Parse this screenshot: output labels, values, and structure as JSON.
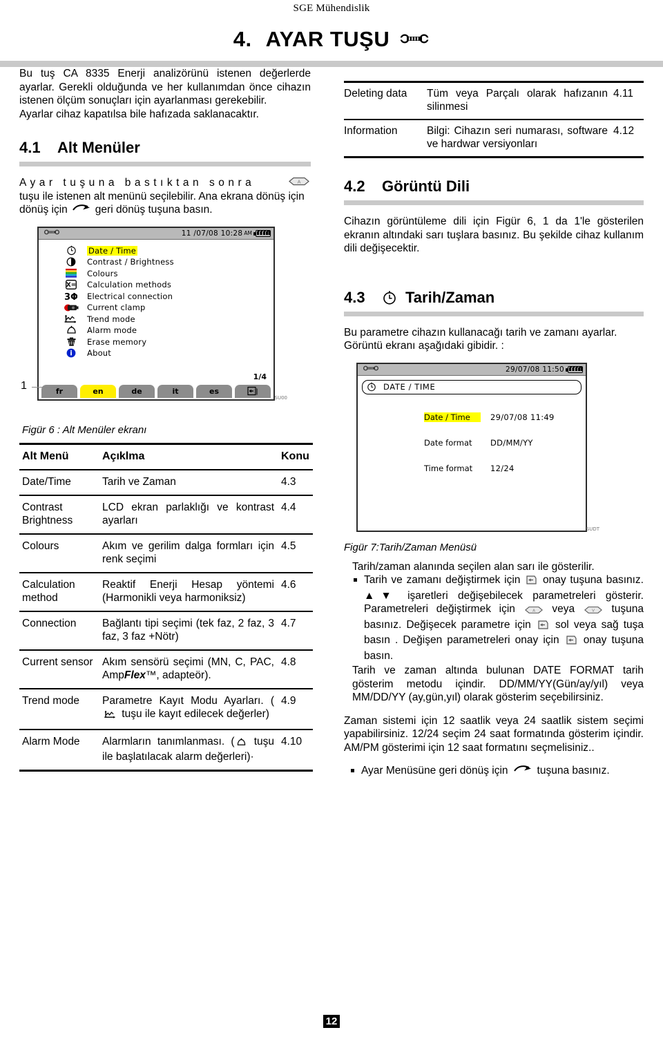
{
  "header": {
    "company": "SGE Mühendislik",
    "chapter_number": "4.",
    "chapter_title": "AYAR TUŞU",
    "chapter_icon": "wrench-icon"
  },
  "intro": {
    "paragraph": "Bu tuş CA 8335 Enerji analizörünü istenen değerlerde ayarlar. Gerekli olduğunda ve her kullanımdan önce cihazın istenen ölçüm sonuçları için ayarlanması gerekebilir.",
    "paragraph2": "Ayarlar cihaz kapatılsa bile hafızada saklanacaktır."
  },
  "section41": {
    "number": "4.1",
    "title": "Alt Menüler",
    "text_a": "Ayar tuşuna bastıktan sonra",
    "text_b": "tuşu ile istenen alt menünü seçilebilir. Ana ekrana dönüş için",
    "text_c": "geri dönüş tuşuna basın."
  },
  "right_table": {
    "rows": [
      {
        "name": "Deleting data",
        "desc": "Tüm veya Parçalı olarak hafızanın silinmesi",
        "ref": "4.11"
      },
      {
        "name": "Information",
        "desc": "Bilgi: Cihazın seri numarası, software ve hardwar versiyonları",
        "ref": "4.12"
      }
    ]
  },
  "section42": {
    "number": "4.2",
    "title": "Görüntü Dili",
    "text": "Cihazın görüntüleme dili için Figür 6, 1 da 1'le gösterilen ekranın altındaki sarı tuşlara basınız. Bu şekilde cihaz kullanım dili değişecektir."
  },
  "section43": {
    "number": "4.3",
    "title": "Tarih/Zaman",
    "icon": "clock-icon",
    "text": "Bu parametre cihazın kullanacağı tarih ve zamanı ayarlar. Görüntü ekranı aşağıdaki gibidir. :"
  },
  "figure6": {
    "caption": "Figür 6 : Alt Menüler ekranı",
    "callout": "1",
    "statusbar": {
      "icon": "wrench-icon",
      "datetime": "11 /07/08  10:28",
      "ampm": "AM",
      "battery": "battery-icon"
    },
    "menu_items": [
      {
        "icon": "clock-icon",
        "label": "Date / Time",
        "highlighted": true
      },
      {
        "icon": "contrast-icon",
        "label": "Contrast / Brightness",
        "highlighted": false
      },
      {
        "icon": "colours-icon",
        "label": "Colours",
        "highlighted": false
      },
      {
        "icon": "calculation-icon",
        "label": "Calculation methods",
        "highlighted": false
      },
      {
        "icon": "three-phase-icon",
        "label": "Electrical connection",
        "highlighted": false
      },
      {
        "icon": "clamp-icon",
        "label": "Current clamp",
        "highlighted": false
      },
      {
        "icon": "trend-icon",
        "label": "Trend mode",
        "highlighted": false
      },
      {
        "icon": "bell-icon",
        "label": "Alarm mode",
        "highlighted": false
      },
      {
        "icon": "trash-icon",
        "label": "Erase memory",
        "highlighted": false
      },
      {
        "icon": "info-icon",
        "label": "About",
        "highlighted": false
      }
    ],
    "page_indicator": "1/4",
    "language_keys": [
      {
        "label": "fr",
        "active": false
      },
      {
        "label": "en",
        "active": true
      },
      {
        "label": "de",
        "active": false
      },
      {
        "label": "it",
        "active": false
      },
      {
        "label": "es",
        "active": false
      }
    ],
    "return_key": "return-icon",
    "corner_tag": "SU00"
  },
  "submenu_table": {
    "headers": [
      "Alt Menü",
      "Açıklma",
      "Konu"
    ],
    "rows": [
      {
        "menu": "Date/Time",
        "desc": "Tarih ve Zaman",
        "ref": "4.3"
      },
      {
        "menu": "Contrast Brightness",
        "desc": "LCD ekran parlaklığı ve kontrast ayarları",
        "ref": "4.4"
      },
      {
        "menu": "Colours",
        "desc": "Akım ve gerilim dalga formları için renk seçimi",
        "ref": "4.5"
      },
      {
        "menu": "Calculation method",
        "desc": "Reaktif Enerji Hesap yöntemi (Harmonikli veya harmoniksiz)",
        "ref": "4.6"
      },
      {
        "menu": "Connection",
        "desc": "Bağlantı tipi seçimi (tek faz, 2 faz, 3 faz, 3 faz +Nötr)",
        "ref": "4.7"
      },
      {
        "menu": "Current sensor",
        "desc_pre": "Akım sensörü seçimi (MN, C, PAC, Amp",
        "desc_em": "Flex",
        "desc_post": "™, adapteör).",
        "ref": "4.8"
      },
      {
        "menu": "Trend mode",
        "desc_pre": "Parametre Kayıt Modu Ayarları. (",
        "desc_icon": "trend-icon",
        "desc_post": " tuşu ile kayıt edilecek değerler)",
        "ref": "4.9"
      },
      {
        "menu": "Alarm Mode",
        "desc_pre": "Alarmların tanımlanması. (",
        "desc_icon": "bell-icon",
        "desc_post": " tuşu ile başlatılacak alarm değerleri)·",
        "ref": "4.10"
      }
    ]
  },
  "figure7": {
    "caption": "Figür 7:Tarih/Zaman Menüsü",
    "statusbar": {
      "icon": "wrench-icon",
      "datetime": "29/07/08  11:50",
      "battery": "battery-icon"
    },
    "title": "DATE / TIME",
    "title_icon": "clock-icon",
    "rows": [
      {
        "label": "Date / Time",
        "value": "29/07/08  11:49",
        "highlighted": true
      },
      {
        "label": "Date format",
        "value": "DD/MM/YY",
        "highlighted": false
      },
      {
        "label": "Time format",
        "value": "12/24",
        "highlighted": false
      }
    ],
    "corner_tag": "SUDT"
  },
  "notes": {
    "lead": "Tarih/zaman alanında seçilen alan sarı ile gösterilir.",
    "b1_a": "Tarih ve zamanı değiştirmek için",
    "b1_b": "onay tuşuna basınız.",
    "b1_c": "işaretleri değişebilecek parametreleri gösterir. Parametreleri değiştirmek için",
    "b1_d": "veya",
    "b1_e": "tuşuna basınız. Değişecek parametre için",
    "b1_f": "sol veya sağ tuşa basın . Değişen parametreleri onay için",
    "b1_g": "onay tuşuna basın.",
    "p2": "Tarih ve zaman altında bulunan DATE FORMAT tarih gösterim metodu içindir. DD/MM/YY(Gün/ay/yıl) veya MM/DD/YY (ay,gün,yıl) olarak gösterim seçebilirsiniz.",
    "p3": "Zaman sistemi için 12 saatlik veya 24 saatlik sistem seçimi yapabilirsiniz. 12/24 seçim 24 saat formatında gösterim içindir. AM/PM gösterimi için 12 saat formatını seçmelisiniz..",
    "b2_a": "Ayar Menüsüne geri dönüş için",
    "b2_b": "tuşuna basınız."
  },
  "footer": {
    "page_number": "12"
  }
}
